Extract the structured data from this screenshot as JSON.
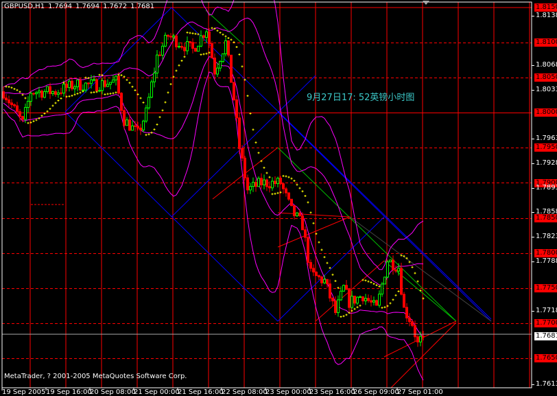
{
  "header": {
    "symbol": "GBPUSD,H1",
    "open": "1.7694",
    "high": "1.7694",
    "low": "1.7672",
    "close": "1.7681"
  },
  "annotation": "9月27日17:  52英镑小时图",
  "copyright": "MetaTrader, ? 2001-2005 MetaQuotes Software Corp.",
  "colors": {
    "background": "#000000",
    "grid": "#ff0000",
    "up": "#00ff00",
    "down": "#ff0000",
    "bands": "#ff00ff",
    "sar": "#ffff00",
    "text": "#ffffff",
    "annotation": "#3cc8c8"
  },
  "chart_data": {
    "type": "candlestick",
    "title": "GBPUSD,H1",
    "bars": 154,
    "ylim": [
      1.76,
      1.8161
    ],
    "y_ticks": [
      {
        "label": "1.8150",
        "value": 1.815,
        "level": true
      },
      {
        "label": "1.8138",
        "value": 1.8138,
        "level": false
      },
      {
        "label": "1.8100",
        "value": 1.81,
        "level": true
      },
      {
        "label": "1.8068",
        "value": 1.8068,
        "level": false
      },
      {
        "label": "1.8050",
        "value": 1.805,
        "level": true
      },
      {
        "label": "1.8033",
        "value": 1.8033,
        "level": false
      },
      {
        "label": "1.8000",
        "value": 1.8,
        "level": true
      },
      {
        "label": "1.7963",
        "value": 1.7963,
        "level": false
      },
      {
        "label": "1.7950",
        "value": 1.795,
        "level": true
      },
      {
        "label": "1.7928",
        "value": 1.7928,
        "level": false
      },
      {
        "label": "1.7900",
        "value": 1.79,
        "level": true
      },
      {
        "label": "1.7893",
        "value": 1.7893,
        "level": false
      },
      {
        "label": "1.7858",
        "value": 1.7858,
        "level": false
      },
      {
        "label": "1.7850",
        "value": 1.785,
        "level": true
      },
      {
        "label": "1.7823",
        "value": 1.7823,
        "level": false
      },
      {
        "label": "1.7800",
        "value": 1.78,
        "level": true
      },
      {
        "label": "1.7788",
        "value": 1.7788,
        "level": false
      },
      {
        "label": "1.7750",
        "value": 1.775,
        "level": true
      },
      {
        "label": "1.7718",
        "value": 1.7718,
        "level": false
      },
      {
        "label": "1.7700",
        "value": 1.77,
        "level": true
      },
      {
        "label": "1.7650",
        "value": 1.765,
        "level": true
      },
      {
        "label": "1.7613",
        "value": 1.7613,
        "level": false
      }
    ],
    "current_price": {
      "label": "1.7681",
      "value": 1.7681
    },
    "x_ticks": [
      {
        "label": "19 Sep 2005",
        "bar": 0
      },
      {
        "label": "19 Sep 16:00",
        "bar": 16
      },
      {
        "label": "20 Sep 08:00",
        "bar": 32
      },
      {
        "label": "21 Sep 00:00",
        "bar": 48
      },
      {
        "label": "21 Sep 16:00",
        "bar": 64
      },
      {
        "label": "22 Sep 08:00",
        "bar": 80
      },
      {
        "label": "23 Sep 00:00",
        "bar": 96
      },
      {
        "label": "23 Sep 16:00",
        "bar": 112
      },
      {
        "label": "26 Sep 09:00",
        "bar": 128
      },
      {
        "label": "27 Sep 01:00",
        "bar": 144
      }
    ],
    "close_path": [
      [
        0,
        1.803
      ],
      [
        7,
        1.7985
      ],
      [
        10,
        1.803
      ],
      [
        19,
        1.803
      ],
      [
        26,
        1.804
      ],
      [
        34,
        1.804
      ],
      [
        41,
        1.8045
      ],
      [
        44,
        1.799
      ],
      [
        49,
        1.797
      ],
      [
        52,
        1.8
      ],
      [
        56,
        1.808
      ],
      [
        60,
        1.811
      ],
      [
        64,
        1.81
      ],
      [
        69,
        1.809
      ],
      [
        74,
        1.812
      ],
      [
        77,
        1.806
      ],
      [
        81,
        1.81
      ],
      [
        84,
        1.802
      ],
      [
        86,
        1.795
      ],
      [
        89,
        1.789
      ],
      [
        94,
        1.79
      ],
      [
        101,
        1.79
      ],
      [
        105,
        1.786
      ],
      [
        109,
        1.784
      ],
      [
        112,
        1.777
      ],
      [
        117,
        1.776
      ],
      [
        121,
        1.7715
      ],
      [
        124,
        1.775
      ],
      [
        126,
        1.773
      ],
      [
        131,
        1.774
      ],
      [
        136,
        1.772
      ],
      [
        140,
        1.779
      ],
      [
        144,
        1.778
      ],
      [
        146,
        1.772
      ],
      [
        149,
        1.77
      ],
      [
        151,
        1.767
      ],
      [
        153,
        1.7681
      ]
    ],
    "indicators": [
      "Bollinger Bands (outer)",
      "Bollinger Bands (inner)",
      "Parabolic SAR"
    ]
  }
}
